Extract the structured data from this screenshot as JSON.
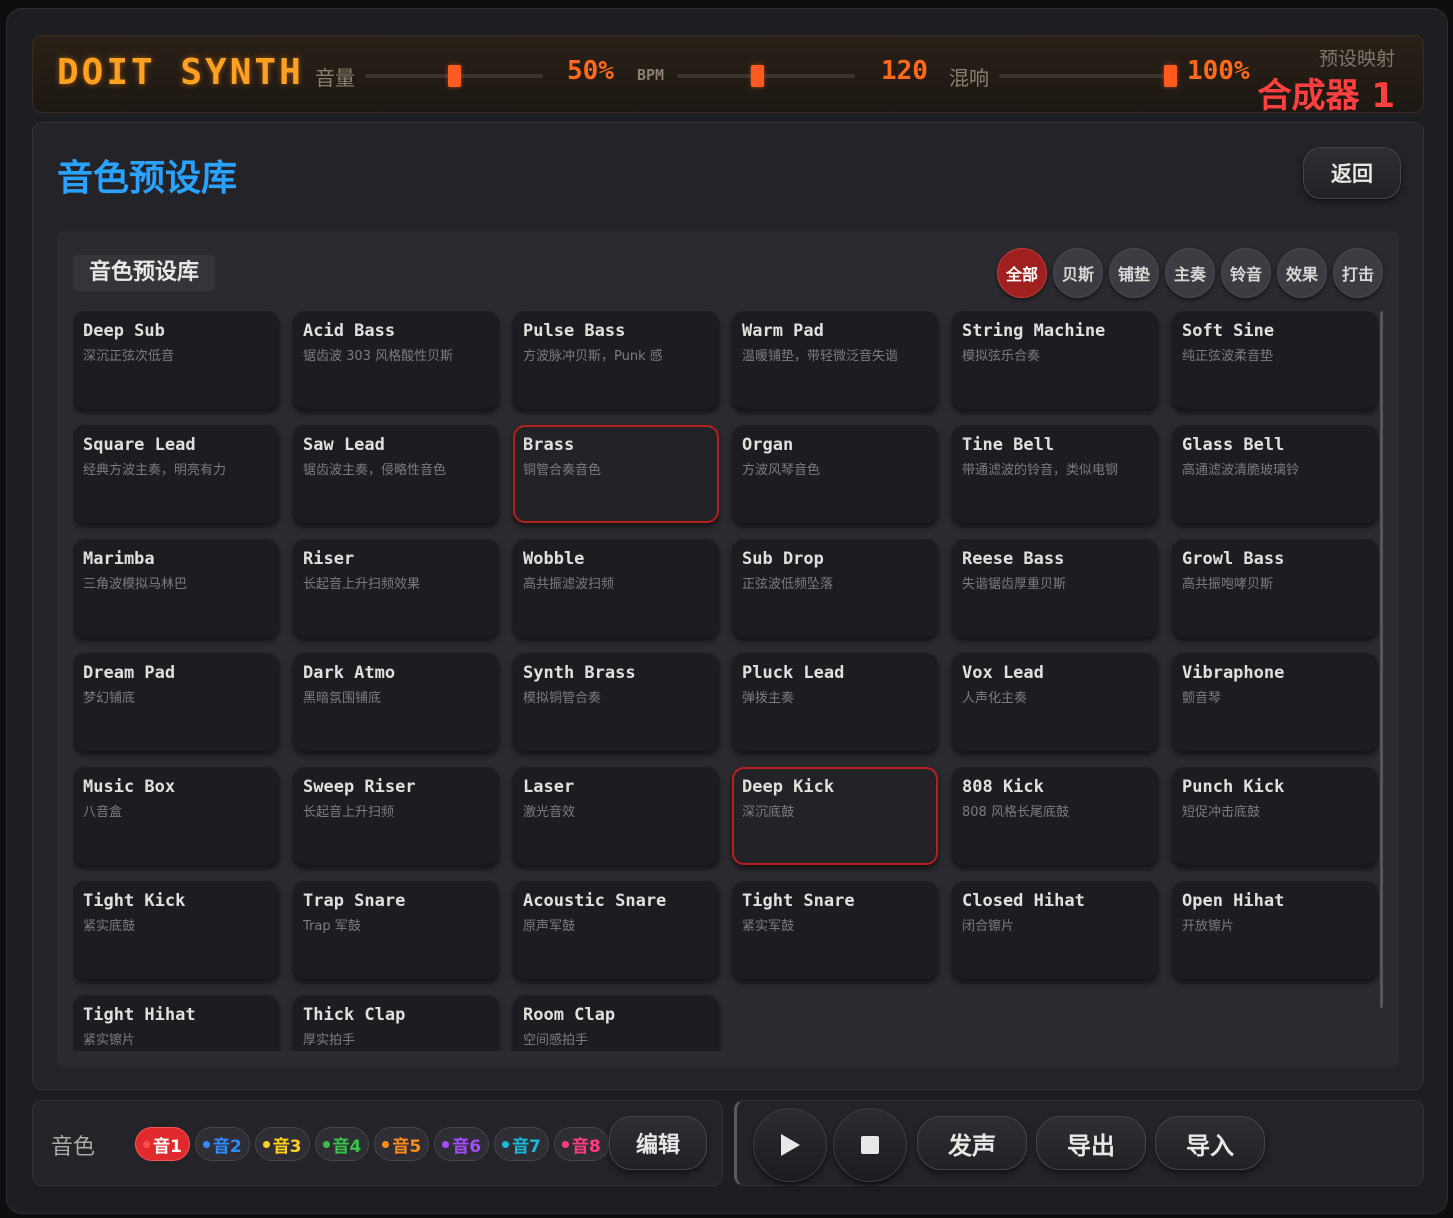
{
  "header": {
    "logo": "DOIT SYNTH",
    "volume_label": "音量",
    "volume_value": "50%",
    "volume_level": 0.5,
    "bpm_label": "BPM",
    "bpm_value": "120",
    "bpm_level": 0.45,
    "reverb_label": "混响",
    "reverb_value": "100%",
    "reverb_level": 1.0,
    "preset_map_label": "预设映射",
    "synth_name": "合成器 1",
    "accent_color": "#ff6a1a"
  },
  "panel": {
    "title": "音色预设库",
    "back_label": "返回"
  },
  "library": {
    "title": "音色预设库",
    "filters": [
      {
        "label": "全部",
        "active": true
      },
      {
        "label": "贝斯",
        "active": false
      },
      {
        "label": "铺垫",
        "active": false
      },
      {
        "label": "主奏",
        "active": false
      },
      {
        "label": "铃音",
        "active": false
      },
      {
        "label": "效果",
        "active": false
      },
      {
        "label": "打击",
        "active": false
      }
    ],
    "presets": [
      {
        "name": "Deep Sub",
        "desc": "深沉正弦次低音"
      },
      {
        "name": "Acid Bass",
        "desc": "锯齿波 303 风格酸性贝斯"
      },
      {
        "name": "Pulse Bass",
        "desc": "方波脉冲贝斯，Punk 感"
      },
      {
        "name": "Warm Pad",
        "desc": "温暖铺垫，带轻微泛音失谐"
      },
      {
        "name": "String Machine",
        "desc": "模拟弦乐合奏"
      },
      {
        "name": "Soft Sine",
        "desc": "纯正弦波柔音垫"
      },
      {
        "name": "Square Lead",
        "desc": "经典方波主奏，明亮有力"
      },
      {
        "name": "Saw Lead",
        "desc": "锯齿波主奏，侵略性音色"
      },
      {
        "name": "Brass",
        "desc": "铜管合奏音色",
        "selected": true
      },
      {
        "name": "Organ",
        "desc": "方波风琴音色"
      },
      {
        "name": "Tine Bell",
        "desc": "带通滤波的铃音，类似电钢"
      },
      {
        "name": "Glass Bell",
        "desc": "高通滤波清脆玻璃铃"
      },
      {
        "name": "Marimba",
        "desc": "三角波模拟马林巴"
      },
      {
        "name": "Riser",
        "desc": "长起音上升扫频效果"
      },
      {
        "name": "Wobble",
        "desc": "高共振滤波扫频"
      },
      {
        "name": "Sub Drop",
        "desc": "正弦波低频坠落"
      },
      {
        "name": "Reese Bass",
        "desc": "失谐锯齿厚重贝斯"
      },
      {
        "name": "Growl Bass",
        "desc": "高共振咆哮贝斯"
      },
      {
        "name": "Dream Pad",
        "desc": "梦幻铺底"
      },
      {
        "name": "Dark Atmo",
        "desc": "黑暗氛围铺底"
      },
      {
        "name": "Synth Brass",
        "desc": "模拟铜管合奏"
      },
      {
        "name": "Pluck Lead",
        "desc": "弹拨主奏"
      },
      {
        "name": "Vox Lead",
        "desc": "人声化主奏"
      },
      {
        "name": "Vibraphone",
        "desc": "颤音琴"
      },
      {
        "name": "Music Box",
        "desc": "八音盒"
      },
      {
        "name": "Sweep Riser",
        "desc": "长起音上升扫频"
      },
      {
        "name": "Laser",
        "desc": "激光音效"
      },
      {
        "name": "Deep Kick",
        "desc": "深沉底鼓",
        "selected": true
      },
      {
        "name": "808 Kick",
        "desc": "808 风格长尾底鼓"
      },
      {
        "name": "Punch Kick",
        "desc": "短促冲击底鼓"
      },
      {
        "name": "Tight Kick",
        "desc": "紧实底鼓"
      },
      {
        "name": "Trap Snare",
        "desc": "Trap 军鼓"
      },
      {
        "name": "Acoustic Snare",
        "desc": "原声军鼓"
      },
      {
        "name": "Tight Snare",
        "desc": "紧实军鼓"
      },
      {
        "name": "Closed Hihat",
        "desc": "闭合镲片"
      },
      {
        "name": "Open Hihat",
        "desc": "开放镲片"
      },
      {
        "name": "Tight Hihat",
        "desc": "紧实镲片"
      },
      {
        "name": "Thick Clap",
        "desc": "厚实拍手"
      },
      {
        "name": "Room Clap",
        "desc": "空间感拍手"
      }
    ]
  },
  "voices": {
    "label": "音色",
    "items": [
      {
        "label": "音1",
        "color": "#ff4d4d",
        "active": true
      },
      {
        "label": "音2",
        "color": "#2f8cff",
        "active": false
      },
      {
        "label": "音3",
        "color": "#ffd21a",
        "active": false
      },
      {
        "label": "音4",
        "color": "#38c24a",
        "active": false
      },
      {
        "label": "音5",
        "color": "#ff8c1a",
        "active": false
      },
      {
        "label": "音6",
        "color": "#a64dff",
        "active": false
      },
      {
        "label": "音7",
        "color": "#1ab8d9",
        "active": false
      },
      {
        "label": "音8",
        "color": "#ff3d7f",
        "active": false
      }
    ],
    "edit_label": "编辑"
  },
  "transport": {
    "play_icon": "play-icon",
    "stop_icon": "stop-icon",
    "sound_label": "发声",
    "export_label": "导出",
    "import_label": "导入"
  }
}
